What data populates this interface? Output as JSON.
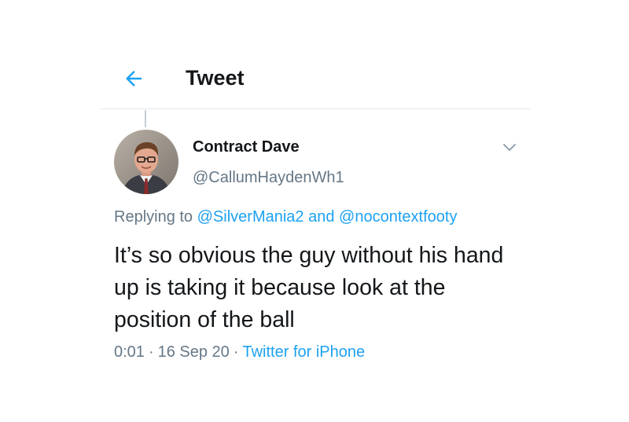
{
  "header": {
    "title": "Tweet",
    "back_icon": "arrow-left-icon",
    "accent": "#1da1f2"
  },
  "tweet": {
    "display_name": "Contract Dave",
    "handle": "@CallumHaydenWh1",
    "menu_icon": "chevron-down-icon",
    "replying_prefix": "Replying to",
    "reply_to_1": "@SilverMania2",
    "reply_joiner": "and",
    "reply_to_2": "@nocontextfooty",
    "text": "It’s so obvious the guy without his hand up is taking it because look at the position of the ball",
    "time": "0:01",
    "date": "16 Sep 20",
    "separator": "·",
    "source": "Twitter for iPhone"
  },
  "colors": {
    "text_primary": "#14171a",
    "text_secondary": "#657786",
    "link": "#1da1f2",
    "divider": "#e1e8ed"
  }
}
